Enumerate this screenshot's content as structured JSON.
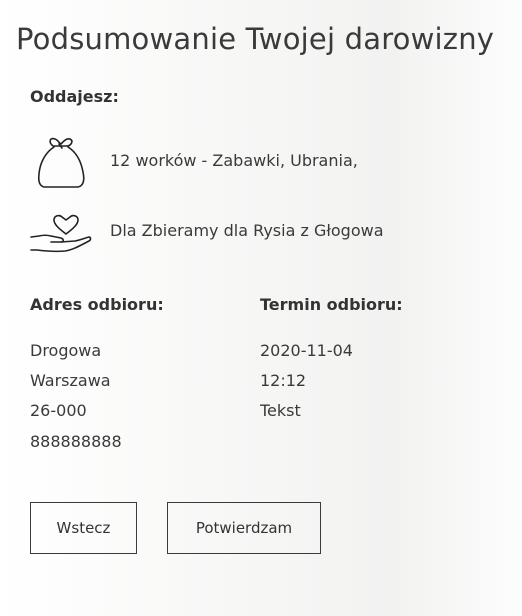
{
  "title": "Podsumowanie Twojej darowizny",
  "give": {
    "label": "Oddajesz:",
    "items_text": "12 worków - Zabawki, Ubrania,",
    "items_icon": "bag-icon",
    "recipient_text": "Dla Zbieramy dla Rysia z Głogowa",
    "recipient_icon": "heart-hand-icon"
  },
  "address": {
    "label": "Adres odbioru:",
    "lines": [
      "Drogowa",
      "Warszawa",
      "26-000",
      "888888888"
    ]
  },
  "term": {
    "label": "Termin odbioru:",
    "lines": [
      "2020-11-04",
      "12:12",
      "Tekst"
    ]
  },
  "buttons": {
    "back": "Wstecz",
    "confirm": "Potwierdzam"
  }
}
